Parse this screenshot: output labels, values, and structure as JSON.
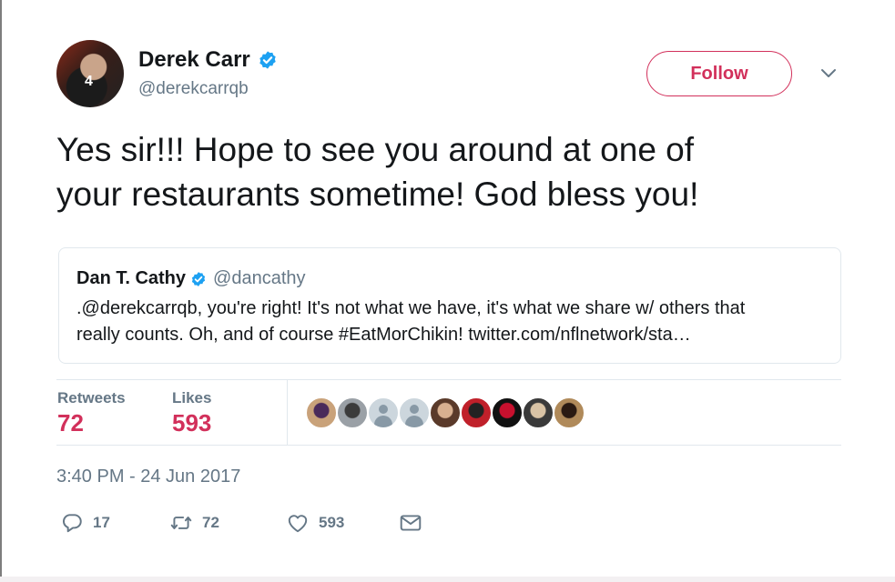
{
  "author": {
    "name": "Derek Carr",
    "handle": "@derekcarrqb",
    "avatar_icon": "profile-photo",
    "avatar_jersey_number": "4",
    "verified": true
  },
  "follow_button": {
    "label": "Follow",
    "color": "#d2305b"
  },
  "tweet": {
    "line1": "Yes sir!!! Hope to see you around at one of",
    "line2": "your restaurants sometime! God bless you!"
  },
  "quoted_tweet": {
    "name": "Dan T. Cathy",
    "handle": "@dancathy",
    "verified": true,
    "line1": ".@derekcarrqb, you're right! It's not what we have, it's what we share w/ others that",
    "line2": "really counts. Oh, and of course #EatMorChikin! twitter.com/nflnetwork/sta…"
  },
  "stats": {
    "retweets_label": "Retweets",
    "retweets_value": "72",
    "likes_label": "Likes",
    "likes_value": "593"
  },
  "likers": [
    {
      "type": "photo",
      "color": "#c9a27a",
      "accent": "#4a2a5a"
    },
    {
      "type": "photo",
      "color": "#9aa0a6",
      "accent": "#3b3b3b"
    },
    {
      "type": "default"
    },
    {
      "type": "default"
    },
    {
      "type": "photo",
      "color": "#5a3a2a",
      "accent": "#d8b090"
    },
    {
      "type": "photo",
      "color": "#c0202a",
      "accent": "#222"
    },
    {
      "type": "photo",
      "color": "#111",
      "accent": "#c8102e"
    },
    {
      "type": "photo",
      "color": "#3a3a3a",
      "accent": "#d9c3a5"
    },
    {
      "type": "photo",
      "color": "#b08a5a",
      "accent": "#2a1a12"
    }
  ],
  "timestamp": "3:40 PM - 24 Jun 2017",
  "actions": {
    "reply_count": "17",
    "retweet_count": "72",
    "like_count": "593"
  },
  "colors": {
    "accent": "#d2305b",
    "verified": "#1da1f2",
    "muted": "#657786",
    "border": "#e1e8ed"
  }
}
